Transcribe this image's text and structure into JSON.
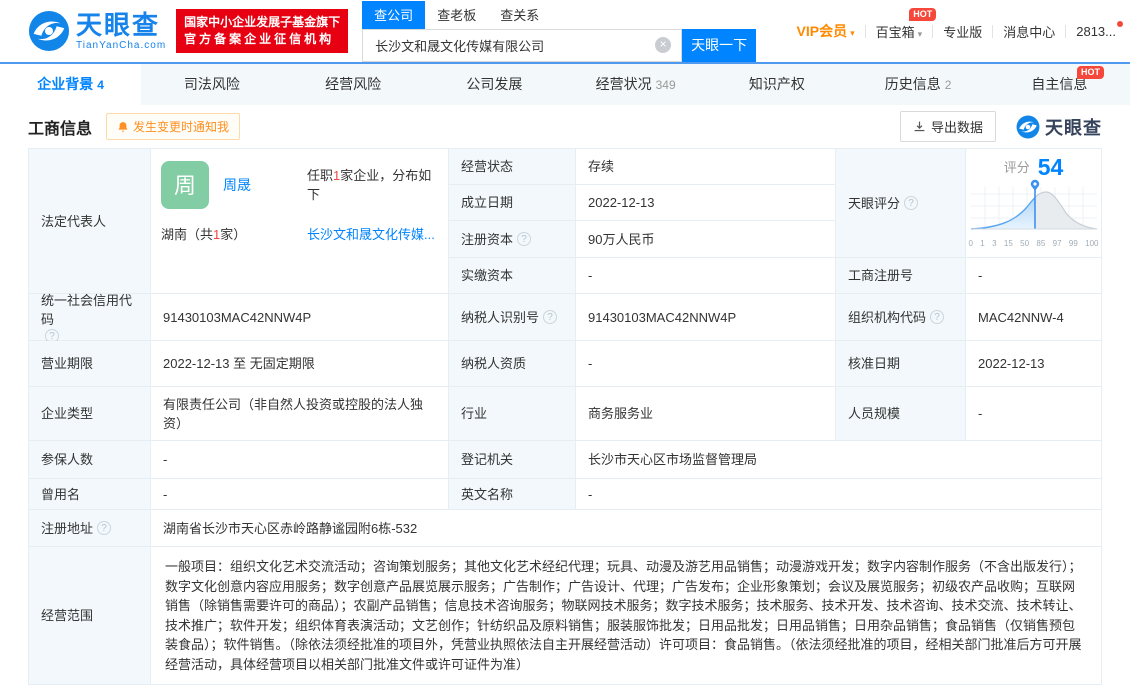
{
  "colors": {
    "accent": "#0084ff",
    "badge_red": "#e60012",
    "hot_red": "#f5483b",
    "vip_orange": "#ff8a00",
    "notify_orange": "#ff9021",
    "avatar_green": "#82cda4",
    "label_bg": "#f2f8fb",
    "border": "#e7eef3"
  },
  "header": {
    "logo": {
      "brand": "天眼查",
      "domain": "TianYanCha.com"
    },
    "badge": {
      "line1": "国家中小企业发展子基金旗下",
      "line2": "官方备案企业征信机构"
    },
    "search": {
      "tabs": [
        {
          "label": "查公司"
        },
        {
          "label": "查老板"
        },
        {
          "label": "查关系"
        }
      ],
      "value": "长沙文和晟文化传媒有限公司",
      "button": "天眼一下"
    },
    "nav": {
      "vip": "VIP会员",
      "toolbox": "百宝箱",
      "toolbox_hot": "HOT",
      "pro": "专业版",
      "messages": "消息中心",
      "user": "2813...",
      "caret": "▾"
    }
  },
  "tabs": [
    {
      "label": "企业背景",
      "count": "4"
    },
    {
      "label": "司法风险"
    },
    {
      "label": "经营风险"
    },
    {
      "label": "公司发展"
    },
    {
      "label": "经营状况",
      "count": "349"
    },
    {
      "label": "知识产权"
    },
    {
      "label": "历史信息",
      "count": "2"
    },
    {
      "label": "自主信息",
      "hot": "HOT"
    }
  ],
  "section": {
    "title": "工商信息",
    "notify": "发生变更时通知我",
    "export": "导出数据",
    "watermark": "天眼查"
  },
  "legal_rep": {
    "label": "法定代表人",
    "avatar": "周",
    "name": "周晟",
    "note_pre": "任职",
    "note_num": "1",
    "note_post": "家企业，分布如下",
    "region_pre": "湖南（共",
    "region_num": "1",
    "region_post": "家）",
    "company": "长沙文和晟文化传媒..."
  },
  "score": {
    "label": "天眼评分",
    "caption": "评分",
    "value": "54",
    "axis": [
      "0",
      "1",
      "3",
      "15",
      "50",
      "85",
      "97",
      "99",
      "100"
    ]
  },
  "fields": {
    "status_label": "经营状态",
    "status": "存续",
    "established_label": "成立日期",
    "established": "2022-12-13",
    "reg_capital_label": "注册资本",
    "reg_capital": "90万人民币",
    "paid_capital_label": "实缴资本",
    "paid_capital": "-",
    "reg_number_label": "工商注册号",
    "reg_number": "-",
    "uscc_label": "统一社会信用代码",
    "uscc": "91430103MAC42NNW4P",
    "taxpayer_id_label": "纳税人识别号",
    "taxpayer_id": "91430103MAC42NNW4P",
    "org_code_label": "组织机构代码",
    "org_code": "MAC42NNW-4",
    "term_label": "营业期限",
    "term": "2022-12-13 至 无固定期限",
    "taxpayer_qual_label": "纳税人资质",
    "taxpayer_qual": "-",
    "approved_label": "核准日期",
    "approved": "2022-12-13",
    "type_label": "企业类型",
    "type": "有限责任公司（非自然人投资或控股的法人独资）",
    "industry_label": "行业",
    "industry": "商务服务业",
    "staff_label": "人员规模",
    "staff": "-",
    "insured_label": "参保人数",
    "insured": "-",
    "authority_label": "登记机关",
    "authority": "长沙市天心区市场监督管理局",
    "former_label": "曾用名",
    "former": "-",
    "english_label": "英文名称",
    "english": "-",
    "address_label": "注册地址",
    "address": "湖南省长沙市天心区赤岭路静谧园附6栋-532",
    "scope_label": "经营范围",
    "scope": "一般项目：组织文化艺术交流活动；咨询策划服务；其他文化艺术经纪代理；玩具、动漫及游艺用品销售；动漫游戏开发；数字内容制作服务（不含出版发行）；数字文化创意内容应用服务；数字创意产品展览展示服务；广告制作；广告设计、代理；广告发布；企业形象策划；会议及展览服务；初级农产品收购；互联网销售（除销售需要许可的商品）；农副产品销售；信息技术咨询服务；物联网技术服务；数字技术服务；技术服务、技术开发、技术咨询、技术交流、技术转让、技术推广；软件开发；组织体育表演活动；文艺创作；针纺织品及原料销售；服装服饰批发；日用品批发；日用品销售；日用杂品销售；食品销售（仅销售预包装食品）；软件销售。（除依法须经批准的项目外，凭营业执照依法自主开展经营活动）许可项目：食品销售。（依法须经批准的项目，经相关部门批准后方可开展经营活动，具体经营项目以相关部门批准文件或许可证件为准）"
  }
}
